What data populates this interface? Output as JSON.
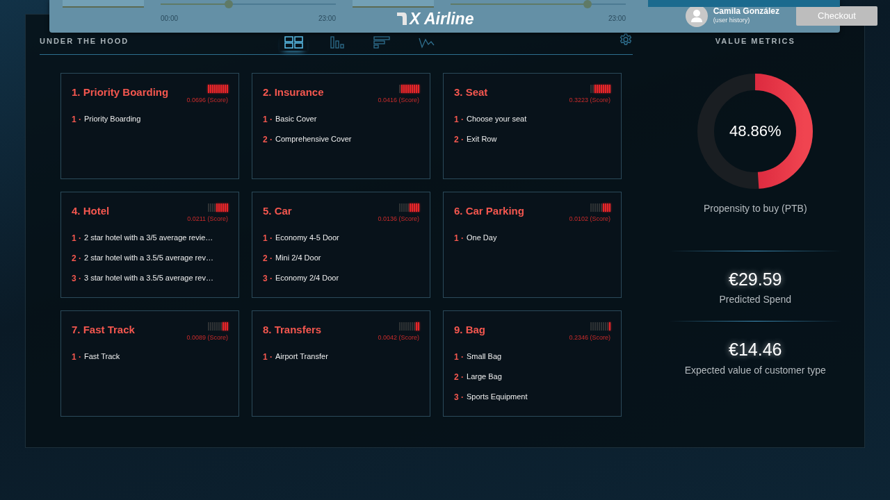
{
  "header": {
    "time_sliders": [
      {
        "level": 0.39,
        "start": "00:00",
        "end": "23:00"
      },
      {
        "level": 0.78,
        "end": "23:00"
      }
    ],
    "logo": "X Airline",
    "user": {
      "name": "Camila González",
      "subtitle": "(user history)"
    },
    "checkout": "Checkout"
  },
  "section": {
    "title": "UNDER THE HOOD",
    "tabs": [
      {
        "kind": "grid",
        "selected": true
      },
      {
        "kind": "bars",
        "selected": false
      },
      {
        "kind": "hbars",
        "selected": false
      },
      {
        "kind": "wave",
        "selected": false
      }
    ],
    "cards": [
      {
        "title": "1. Priority Boarding",
        "level": 1.0,
        "score": "0.0696 (Score)",
        "items": [
          {
            "rank": "1 ·",
            "label": "Priority Boarding"
          }
        ]
      },
      {
        "title": "2. Insurance",
        "level": 0.9,
        "score": "0.0416 (Score)",
        "items": [
          {
            "rank": "1 ·",
            "label": "Basic Cover"
          },
          {
            "rank": "2 ·",
            "label": "Comprehensive Cover"
          }
        ]
      },
      {
        "title": "3. Seat",
        "level": 0.8,
        "score": "0.3223 (Score)",
        "items": [
          {
            "rank": "1 ·",
            "label": "Choose your seat"
          },
          {
            "rank": "2 ·",
            "label": "Exit Row"
          }
        ]
      },
      {
        "title": "4. Hotel",
        "level": 0.6,
        "score": "0.0211 (Score)",
        "items": [
          {
            "rank": "1 ·",
            "label": "2 star hotel with a 3/5 average revie…"
          },
          {
            "rank": "2 ·",
            "label": "2 star hotel with a 3.5/5 average rev…"
          },
          {
            "rank": "3 ·",
            "label": "3 star hotel with a 3.5/5 average rev…"
          }
        ]
      },
      {
        "title": "5. Car",
        "level": 0.5,
        "score": "0.0136 (Score)",
        "items": [
          {
            "rank": "1 ·",
            "label": "Economy 4-5 Door"
          },
          {
            "rank": "2 ·",
            "label": "Mini 2/4 Door"
          },
          {
            "rank": "3 ·",
            "label": "Economy 2/4 Door"
          }
        ]
      },
      {
        "title": "6. Car Parking",
        "level": 0.4,
        "score": "0.0102 (Score)",
        "items": [
          {
            "rank": "1 ·",
            "label": "One Day"
          }
        ]
      },
      {
        "title": "7. Fast Track",
        "level": 0.3,
        "score": "0.0089 (Score)",
        "items": [
          {
            "rank": "1 ·",
            "label": "Fast Track"
          }
        ]
      },
      {
        "title": "8. Transfers",
        "level": 0.2,
        "score": "0.0042 (Score)",
        "items": [
          {
            "rank": "1 ·",
            "label": "Airport Transfer"
          }
        ]
      },
      {
        "title": "9. Bag",
        "level": 0.1,
        "score": "0.2346 (Score)",
        "items": [
          {
            "rank": "1 ·",
            "label": "Small Bag"
          },
          {
            "rank": "2 ·",
            "label": "Large Bag"
          },
          {
            "rank": "3 ·",
            "label": "Sports Equipment"
          }
        ]
      }
    ]
  },
  "value_metrics": {
    "title": "VALUE METRICS",
    "ptb": {
      "level": 0.4886,
      "value": "48.86%",
      "label": "Propensity to buy (PTB)"
    },
    "metrics": [
      {
        "value": "€29.59",
        "label": "Predicted Spend"
      },
      {
        "value": "€14.46",
        "label": "Expected value of customer type"
      }
    ]
  }
}
